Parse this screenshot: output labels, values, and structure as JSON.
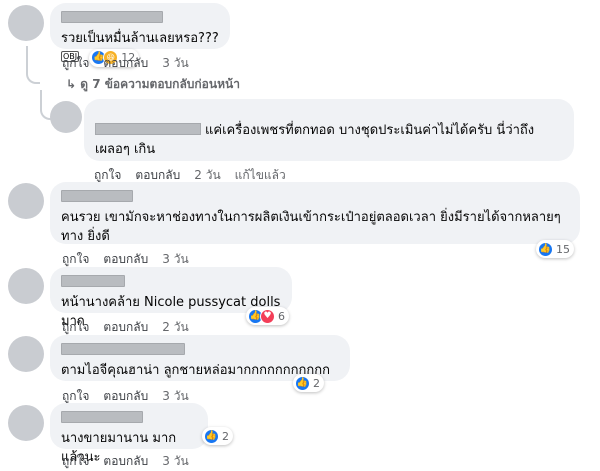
{
  "comments": [
    {
      "text": "รวยเป็นหมื่นล้านเลยหรอ???",
      "emoji": "OBJ",
      "reaction_count": "12",
      "like": "ถูกใจ",
      "reply": "ตอบกลับ",
      "time": "3 วัน"
    },
    {
      "view_more": "ดู 7 ข้อความตอบกลับก่อนหน้า"
    },
    {
      "text": "แค่เครื่องเพชรที่ตกทอด บางชุดประเมินค่าไม่ได้ครับ นี่ว่าถึง เผลอๆ เกิน",
      "like": "ถูกใจ",
      "reply": "ตอบกลับ",
      "time": "2 วัน",
      "edited": "แก้ไขแล้ว"
    },
    {
      "text": "คนรวย เขามักจะหาช่องทางในการผลิตเงินเข้ากระเป๋าอยู่ตลอดเวลา ยิ่งมีรายได้จากหลายๆทาง ยิ่งดี",
      "reaction_count": "15",
      "like": "ถูกใจ",
      "reply": "ตอบกลับ",
      "time": "3 วัน"
    },
    {
      "text": "หน้านางคล้าย Nicole pussycat dolls มาก",
      "reaction_count": "6",
      "like": "ถูกใจ",
      "reply": "ตอบกลับ",
      "time": "2 วัน"
    },
    {
      "text": "ตามไอจีคุณฮาน่า ลูกชายหล่อมากกกกกกกกกกก",
      "reaction_count": "2",
      "like": "ถูกใจ",
      "reply": "ตอบกลับ",
      "time": "3 วัน"
    },
    {
      "text": "นางขายมานาน มากแล้วนะ",
      "reaction_count": "2",
      "like": "ถูกใจ",
      "reply": "ตอบกลับ",
      "time": "3 วัน"
    }
  ]
}
